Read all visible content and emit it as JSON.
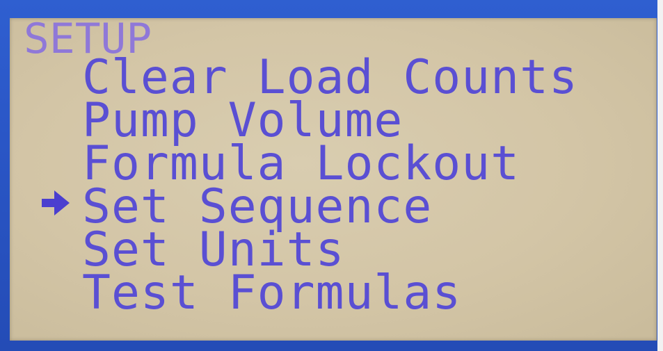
{
  "screen": {
    "title": "SETUP",
    "cursor_icon": "arrow-right-icon",
    "selected_index": 3,
    "items": [
      {
        "label": "Clear Load Counts"
      },
      {
        "label": "Pump Volume"
      },
      {
        "label": "Formula Lockout"
      },
      {
        "label": "Set Sequence"
      },
      {
        "label": "Set Units"
      },
      {
        "label": "Test Formulas"
      }
    ]
  },
  "colors": {
    "bezel": "#2a56c6",
    "lcd_background": "#d3c5a6",
    "text": "#5a4fd3",
    "title_text": "#8f78d8"
  }
}
